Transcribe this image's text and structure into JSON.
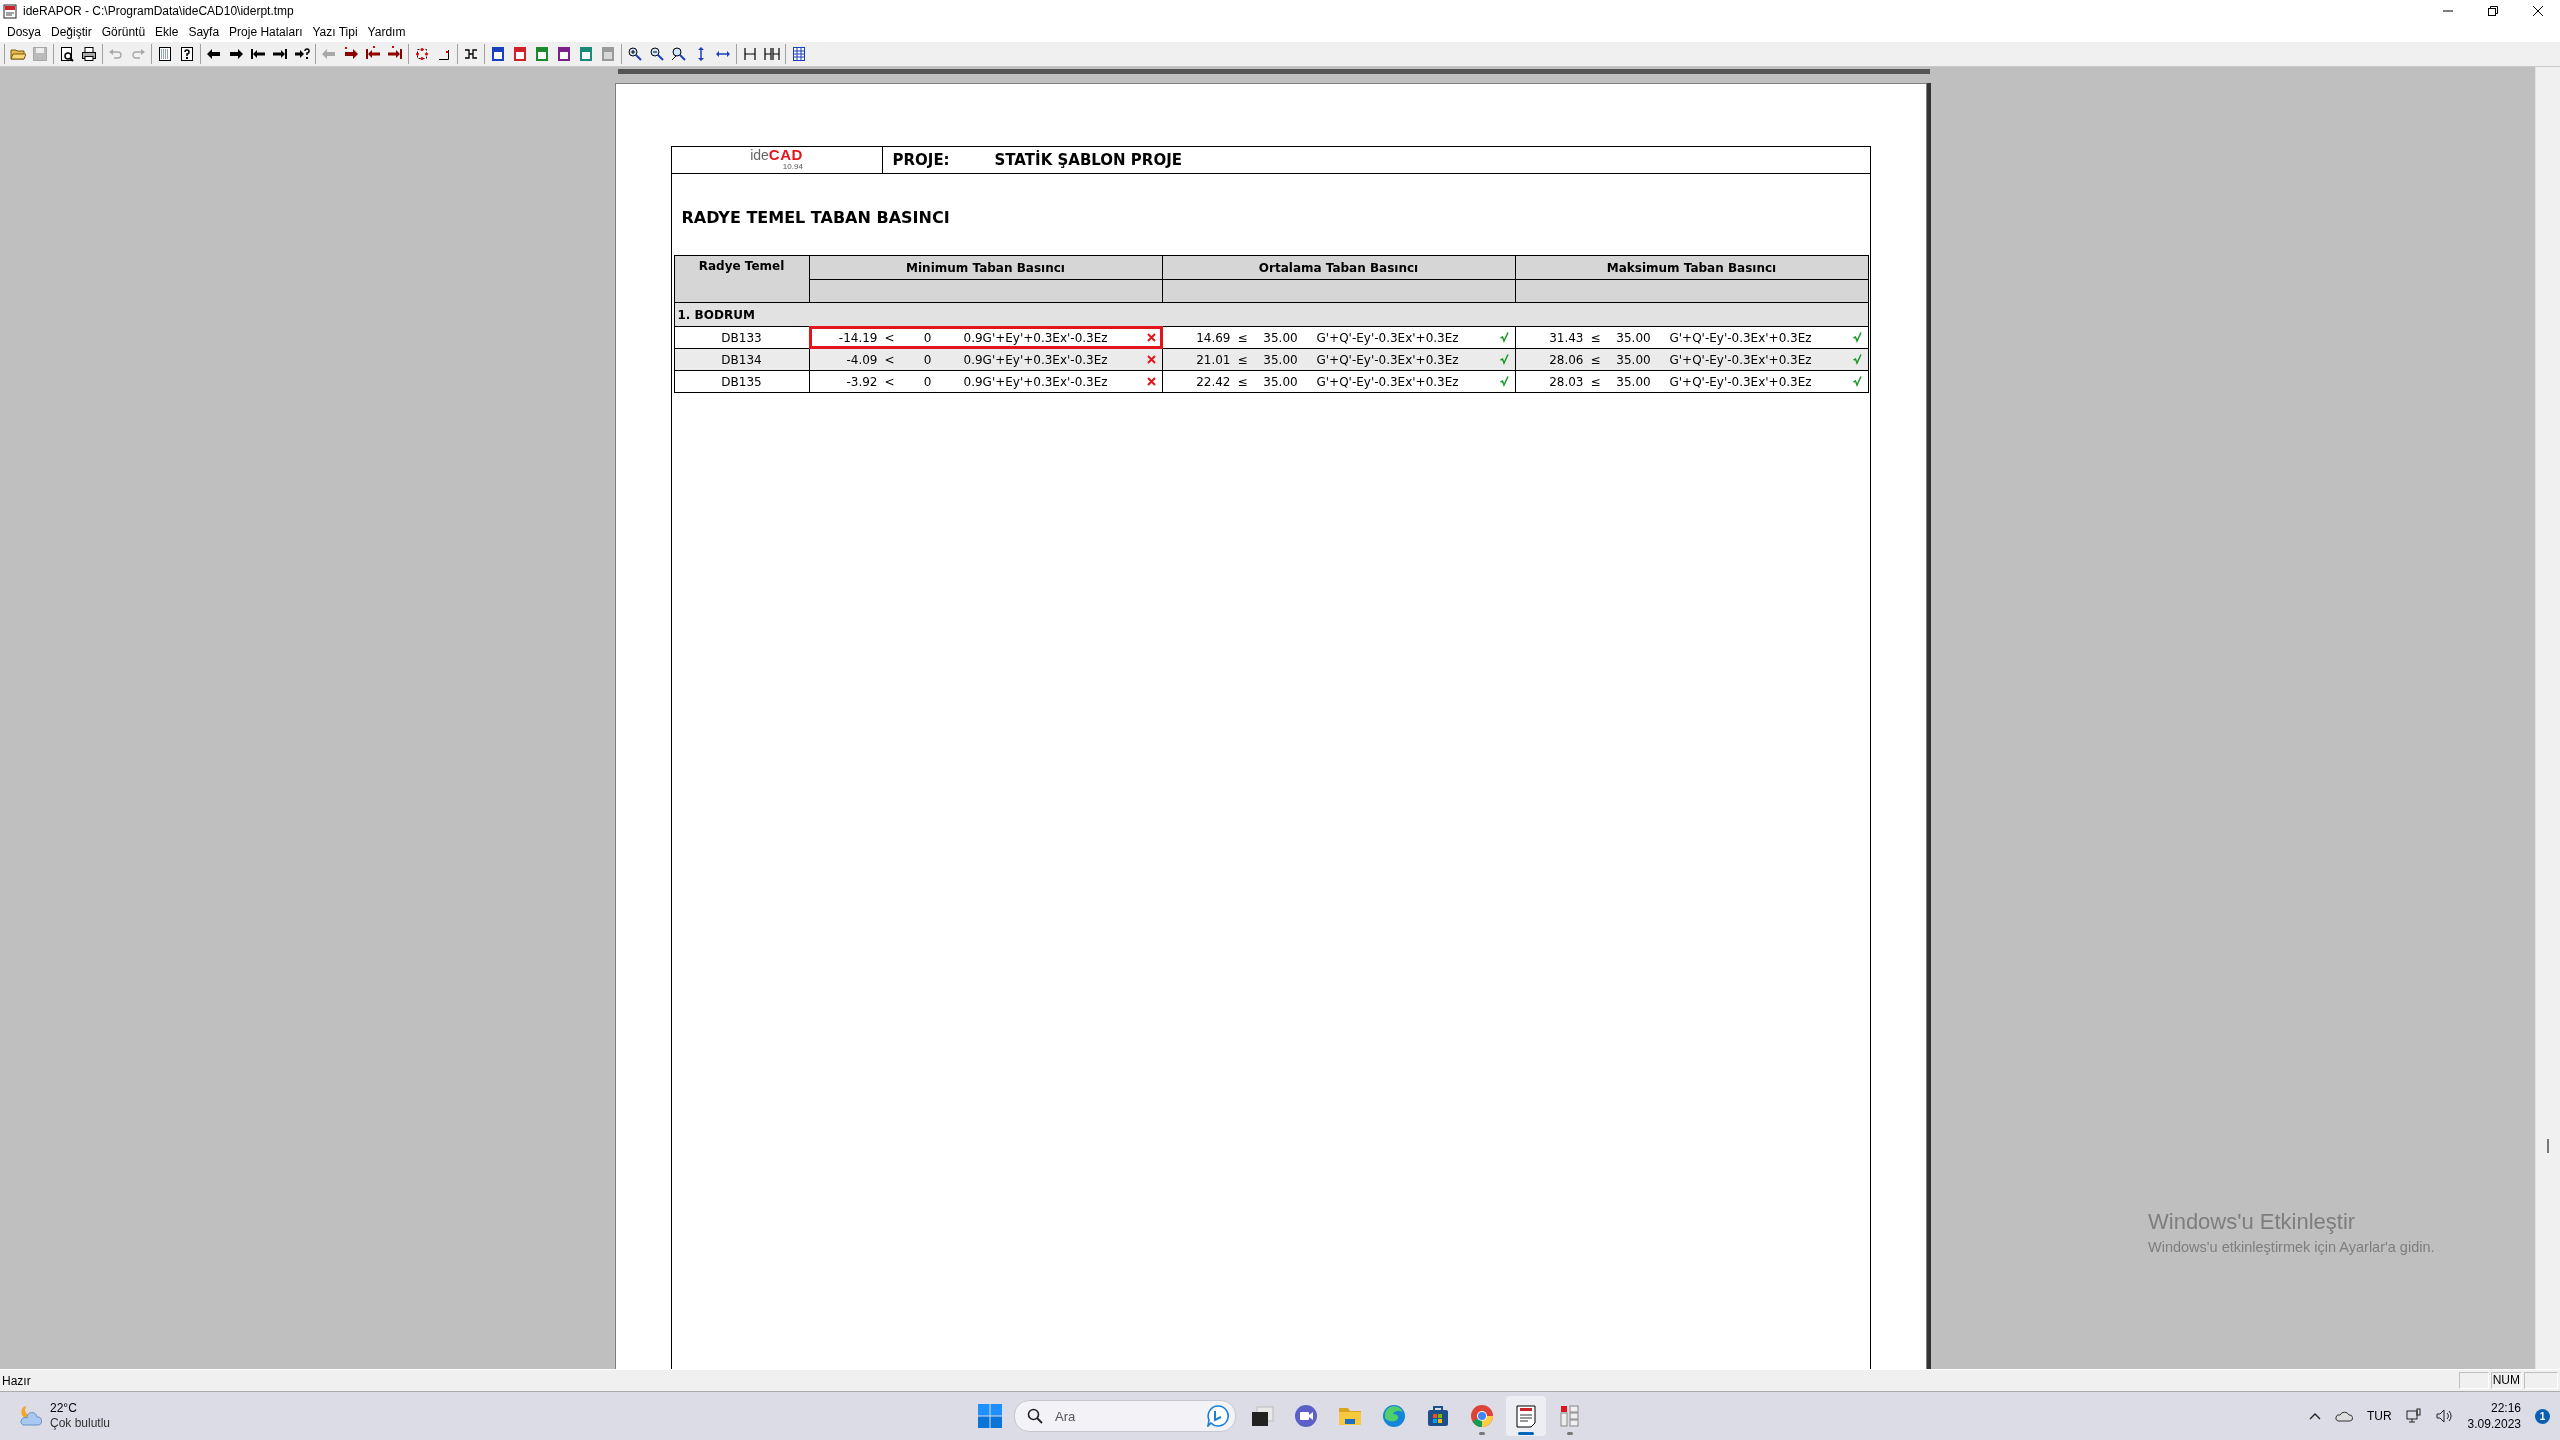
{
  "window": {
    "title": "ideRAPOR - C:\\ProgramData\\ideCAD10\\iderpt.tmp"
  },
  "menu": [
    "Dosya",
    "Değiştir",
    "Görüntü",
    "Ekle",
    "Sayfa",
    "Proje Hataları",
    "Yazı Tipi",
    "Yardım"
  ],
  "toolbar": [
    [
      {
        "kind": "folder",
        "disabled": false
      },
      {
        "kind": "disk",
        "disabled": true
      }
    ],
    [
      {
        "kind": "preview",
        "disabled": false
      },
      {
        "kind": "printer",
        "disabled": false
      }
    ],
    [
      {
        "kind": "undo",
        "disabled": true
      },
      {
        "kind": "redo",
        "disabled": true
      }
    ],
    [
      {
        "kind": "list-page",
        "disabled": false
      },
      {
        "kind": "help-page",
        "disabled": false
      }
    ],
    [
      {
        "kind": "arrow-left",
        "disabled": false
      },
      {
        "kind": "arrow-right",
        "disabled": false
      },
      {
        "kind": "arrow-first",
        "disabled": false
      },
      {
        "kind": "arrow-last",
        "disabled": false
      },
      {
        "kind": "arrow-goto",
        "disabled": false
      }
    ],
    [
      {
        "kind": "error-left",
        "disabled": true
      },
      {
        "kind": "error-right",
        "disabled": false
      },
      {
        "kind": "error-first",
        "disabled": false
      },
      {
        "kind": "error-last",
        "disabled": false
      }
    ],
    [
      {
        "kind": "frame",
        "disabled": false
      },
      {
        "kind": "corner",
        "disabled": false
      }
    ],
    [
      {
        "kind": "shuffle",
        "disabled": false
      }
    ],
    [
      {
        "kind": "page-layout",
        "color": "#1a3fc0",
        "disabled": false
      },
      {
        "kind": "page-layout",
        "color": "#d0202a",
        "disabled": false
      },
      {
        "kind": "page-layout",
        "color": "#1b8a2e",
        "disabled": false
      },
      {
        "kind": "page-layout",
        "color": "#7a1f8c",
        "disabled": false
      },
      {
        "kind": "page-layout",
        "color": "#1a8a7a",
        "disabled": false
      },
      {
        "kind": "page-layout",
        "color": "#9a9a9a",
        "disabled": true
      }
    ],
    [
      {
        "kind": "zoom-in",
        "disabled": false
      },
      {
        "kind": "zoom-out",
        "disabled": false
      },
      {
        "kind": "zoom-fit",
        "disabled": false
      },
      {
        "kind": "fit-height",
        "disabled": false
      },
      {
        "kind": "fit-width",
        "disabled": false
      }
    ],
    [
      {
        "kind": "split-two",
        "disabled": false
      },
      {
        "kind": "split-four",
        "disabled": false
      }
    ],
    [
      {
        "kind": "columns",
        "disabled": false
      }
    ]
  ],
  "report": {
    "logo": {
      "prefix": "ide",
      "name": "CAD",
      "version": "10.94"
    },
    "project_label": "PROJE:",
    "project_name": "STATİK ŞABLON PROJE",
    "title": "RADYE TEMEL TABAN BASINCI",
    "table": {
      "columns": [
        "Radye Temel",
        "Minimum Taban Basıncı",
        "Ortalama Taban Basıncı",
        "Maksimum Taban Basıncı"
      ],
      "groups": [
        {
          "label": "1. BODRUM",
          "rows": [
            {
              "name": "DB133",
              "checks": [
                {
                  "value": "-14.19",
                  "op": "<",
                  "limit": "0",
                  "combo": "0.9G'+Ey'+0.3Ex'-0.3Ez",
                  "ok": false,
                  "highlighted": true
                },
                {
                  "value": "14.69",
                  "op": "≤",
                  "limit": "35.00",
                  "combo": "G'+Q'-Ey'-0.3Ex'+0.3Ez",
                  "ok": true,
                  "highlighted": false
                },
                {
                  "value": "31.43",
                  "op": "≤",
                  "limit": "35.00",
                  "combo": "G'+Q'-Ey'-0.3Ex'+0.3Ez",
                  "ok": true,
                  "highlighted": false
                }
              ]
            },
            {
              "name": "DB134",
              "checks": [
                {
                  "value": "-4.09",
                  "op": "<",
                  "limit": "0",
                  "combo": "0.9G'+Ey'+0.3Ex'-0.3Ez",
                  "ok": false,
                  "highlighted": false
                },
                {
                  "value": "21.01",
                  "op": "≤",
                  "limit": "35.00",
                  "combo": "G'+Q'-Ey'-0.3Ex'+0.3Ez",
                  "ok": true,
                  "highlighted": false
                },
                {
                  "value": "28.06",
                  "op": "≤",
                  "limit": "35.00",
                  "combo": "G'+Q'-Ey'-0.3Ex'+0.3Ez",
                  "ok": true,
                  "highlighted": false
                }
              ]
            },
            {
              "name": "DB135",
              "checks": [
                {
                  "value": "-3.92",
                  "op": "<",
                  "limit": "0",
                  "combo": "0.9G'+Ey'+0.3Ex'-0.3Ez",
                  "ok": false,
                  "highlighted": false
                },
                {
                  "value": "22.42",
                  "op": "≤",
                  "limit": "35.00",
                  "combo": "G'+Q'-Ey'-0.3Ex'+0.3Ez",
                  "ok": true,
                  "highlighted": false
                },
                {
                  "value": "28.03",
                  "op": "≤",
                  "limit": "35.00",
                  "combo": "G'+Q'-Ey'-0.3Ex'+0.3Ez",
                  "ok": true,
                  "highlighted": false
                }
              ]
            }
          ]
        }
      ]
    }
  },
  "activation_notice": {
    "title": "Windows'u Etkinleştir",
    "text": "Windows'u etkinleştirmek için Ayarlar'a gidin."
  },
  "status_bar": {
    "text": "Hazır",
    "indicators": [
      "NUM"
    ]
  },
  "taskbar": {
    "weather": {
      "temperature": "22°C",
      "condition": "Çok bulutlu"
    },
    "search": {
      "placeholder": "Ara"
    },
    "apps": [
      {
        "kind": "task-view",
        "running": false,
        "active": false
      },
      {
        "kind": "chat",
        "running": false,
        "active": false
      },
      {
        "kind": "folder",
        "running": false,
        "active": false
      },
      {
        "kind": "edge",
        "running": false,
        "active": false
      },
      {
        "kind": "store",
        "running": false,
        "active": false
      },
      {
        "kind": "chrome",
        "running": true,
        "active": false
      },
      {
        "kind": "report",
        "running": true,
        "active": true
      },
      {
        "kind": "widgets",
        "running": true,
        "active": false
      }
    ],
    "tray": {
      "language": "TUR",
      "time": "22:16",
      "date": "3.09.2023",
      "notifications": "1"
    }
  }
}
